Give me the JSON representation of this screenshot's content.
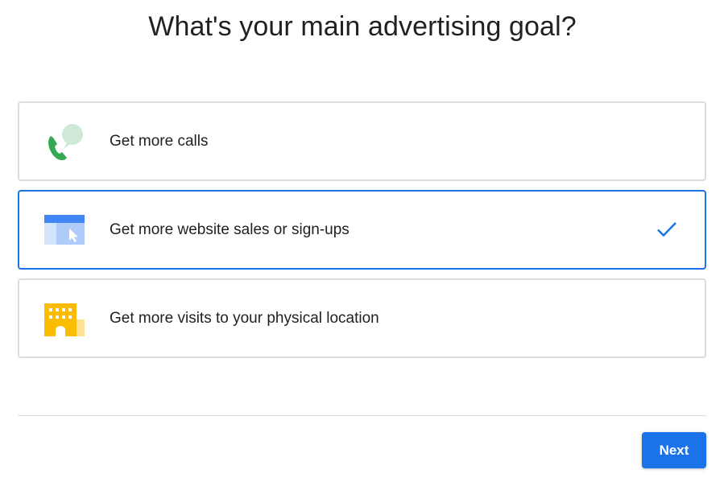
{
  "page": {
    "title": "What's your main advertising goal?"
  },
  "options": [
    {
      "label": "Get more calls",
      "icon": "phone-with-speech-bubble-icon",
      "selected": false
    },
    {
      "label": "Get more website sales or sign-ups",
      "icon": "browser-window-cursor-icon",
      "selected": true
    },
    {
      "label": "Get more visits to your physical location",
      "icon": "storefront-building-icon",
      "selected": false
    }
  ],
  "footer": {
    "next_label": "Next"
  },
  "colors": {
    "accent": "#1a73e8",
    "border": "#dadce0",
    "text": "#202124",
    "phone_green": "#34a853",
    "bubble_green": "#ceead6",
    "building_yellow": "#fbbc04",
    "building_light": "#fde293"
  }
}
